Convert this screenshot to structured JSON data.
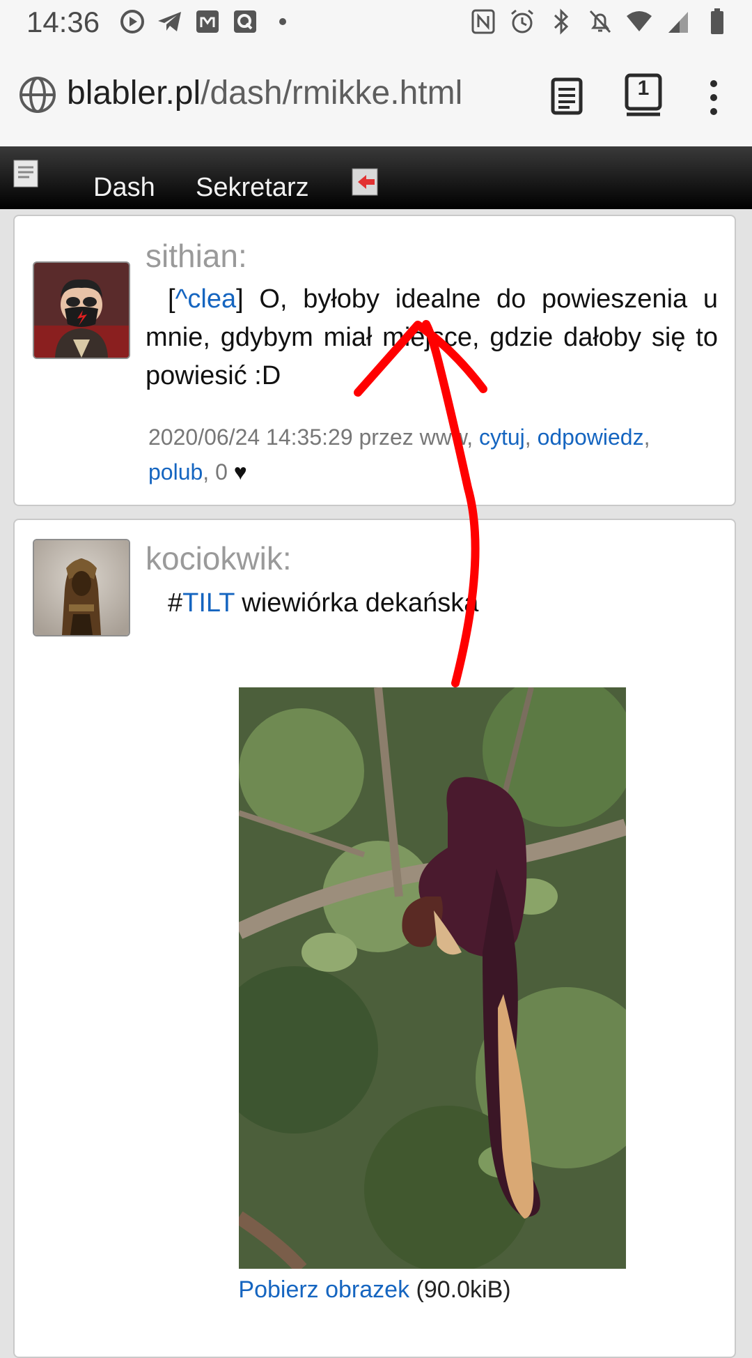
{
  "status_bar": {
    "time": "14:36"
  },
  "browser": {
    "url_domain": "blabler.pl",
    "url_path": "/dash/rmikke.html",
    "tab_count": "1"
  },
  "site_nav": {
    "items": [
      {
        "label": "Dash"
      },
      {
        "label": "Sekretarz"
      }
    ]
  },
  "posts": [
    {
      "author": "sithian:",
      "mention_prefix": "[",
      "mention": "^clea",
      "mention_suffix": "]",
      "text": " O, byłoby idealne do powieszenia u mnie, gdybym miał miejsce, gdzie dałoby się to powiesić :D",
      "timestamp": "2020/06/24 14:35:29",
      "via": "przez www,",
      "quote_label": "cytuj",
      "reply_label": "odpowiedz",
      "like_label": "polub",
      "likes": "0",
      "heart": "♥"
    },
    {
      "author": "kociokwik:",
      "hashtag_prefix": "#",
      "hashtag": "TILT",
      "text": " wiewiórka dekańska",
      "download_label": "Pobierz obrazek",
      "download_size": "(90.0kiB)"
    }
  ],
  "colors": {
    "link": "#1565c0",
    "annotation_arrow": "#ff0000"
  }
}
